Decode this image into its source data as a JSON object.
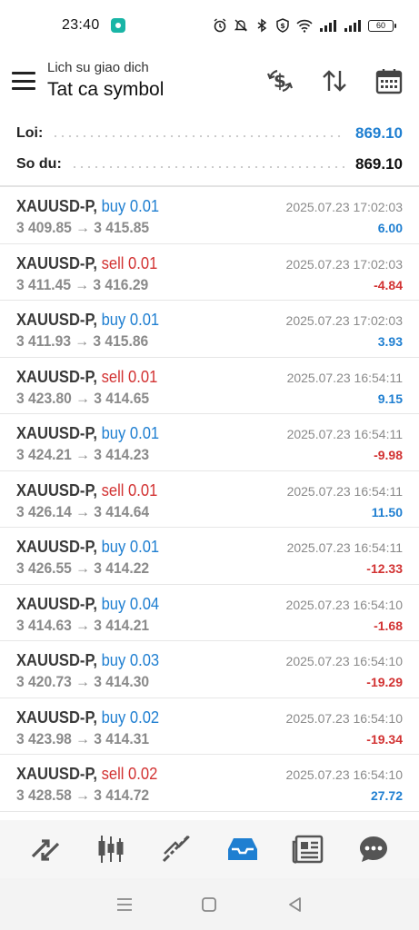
{
  "status_bar": {
    "time": "23:40",
    "battery": "60"
  },
  "header": {
    "subtitle": "Lich su giao dich",
    "title": "Tat ca symbol"
  },
  "summary": [
    {
      "label": "Loi:",
      "value": "869.10",
      "color": "#1f7fd1"
    },
    {
      "label": "So du:",
      "value": "869.10",
      "color": "#111111"
    }
  ],
  "deals": [
    {
      "symbol": "XAUUSD-P,",
      "type": "buy",
      "volume": "0.01",
      "prices": "3 409.85 → 3 415.85",
      "time": "2025.07.23 17:02:03",
      "profit": "6.00"
    },
    {
      "symbol": "XAUUSD-P,",
      "type": "sell",
      "volume": "0.01",
      "prices": "3 411.45 → 3 416.29",
      "time": "2025.07.23 17:02:03",
      "profit": "-4.84"
    },
    {
      "symbol": "XAUUSD-P,",
      "type": "buy",
      "volume": "0.01",
      "prices": "3 411.93 → 3 415.86",
      "time": "2025.07.23 17:02:03",
      "profit": "3.93"
    },
    {
      "symbol": "XAUUSD-P,",
      "type": "sell",
      "volume": "0.01",
      "prices": "3 423.80 → 3 414.65",
      "time": "2025.07.23 16:54:11",
      "profit": "9.15"
    },
    {
      "symbol": "XAUUSD-P,",
      "type": "buy",
      "volume": "0.01",
      "prices": "3 424.21 → 3 414.23",
      "time": "2025.07.23 16:54:11",
      "profit": "-9.98"
    },
    {
      "symbol": "XAUUSD-P,",
      "type": "sell",
      "volume": "0.01",
      "prices": "3 426.14 → 3 414.64",
      "time": "2025.07.23 16:54:11",
      "profit": "11.50"
    },
    {
      "symbol": "XAUUSD-P,",
      "type": "buy",
      "volume": "0.01",
      "prices": "3 426.55 → 3 414.22",
      "time": "2025.07.23 16:54:11",
      "profit": "-12.33"
    },
    {
      "symbol": "XAUUSD-P,",
      "type": "buy",
      "volume": "0.04",
      "prices": "3 414.63 → 3 414.21",
      "time": "2025.07.23 16:54:10",
      "profit": "-1.68"
    },
    {
      "symbol": "XAUUSD-P,",
      "type": "buy",
      "volume": "0.03",
      "prices": "3 420.73 → 3 414.30",
      "time": "2025.07.23 16:54:10",
      "profit": "-19.29"
    },
    {
      "symbol": "XAUUSD-P,",
      "type": "buy",
      "volume": "0.02",
      "prices": "3 423.98 → 3 414.31",
      "time": "2025.07.23 16:54:10",
      "profit": "-19.34"
    },
    {
      "symbol": "XAUUSD-P,",
      "type": "sell",
      "volume": "0.02",
      "prices": "3 428.58 → 3 414.72",
      "time": "2025.07.23 16:54:10",
      "profit": "27.72"
    }
  ],
  "tabs": [
    {
      "name": "quotes-icon",
      "active": false
    },
    {
      "name": "chart-icon",
      "active": false
    },
    {
      "name": "trade-icon",
      "active": false
    },
    {
      "name": "history-icon",
      "active": true
    },
    {
      "name": "news-icon",
      "active": false
    },
    {
      "name": "chat-icon",
      "active": false
    }
  ],
  "colors": {
    "buy": "#1f7fd1",
    "sell": "#d23232",
    "active_tab": "#1f7fd1",
    "icon": "#555555"
  }
}
